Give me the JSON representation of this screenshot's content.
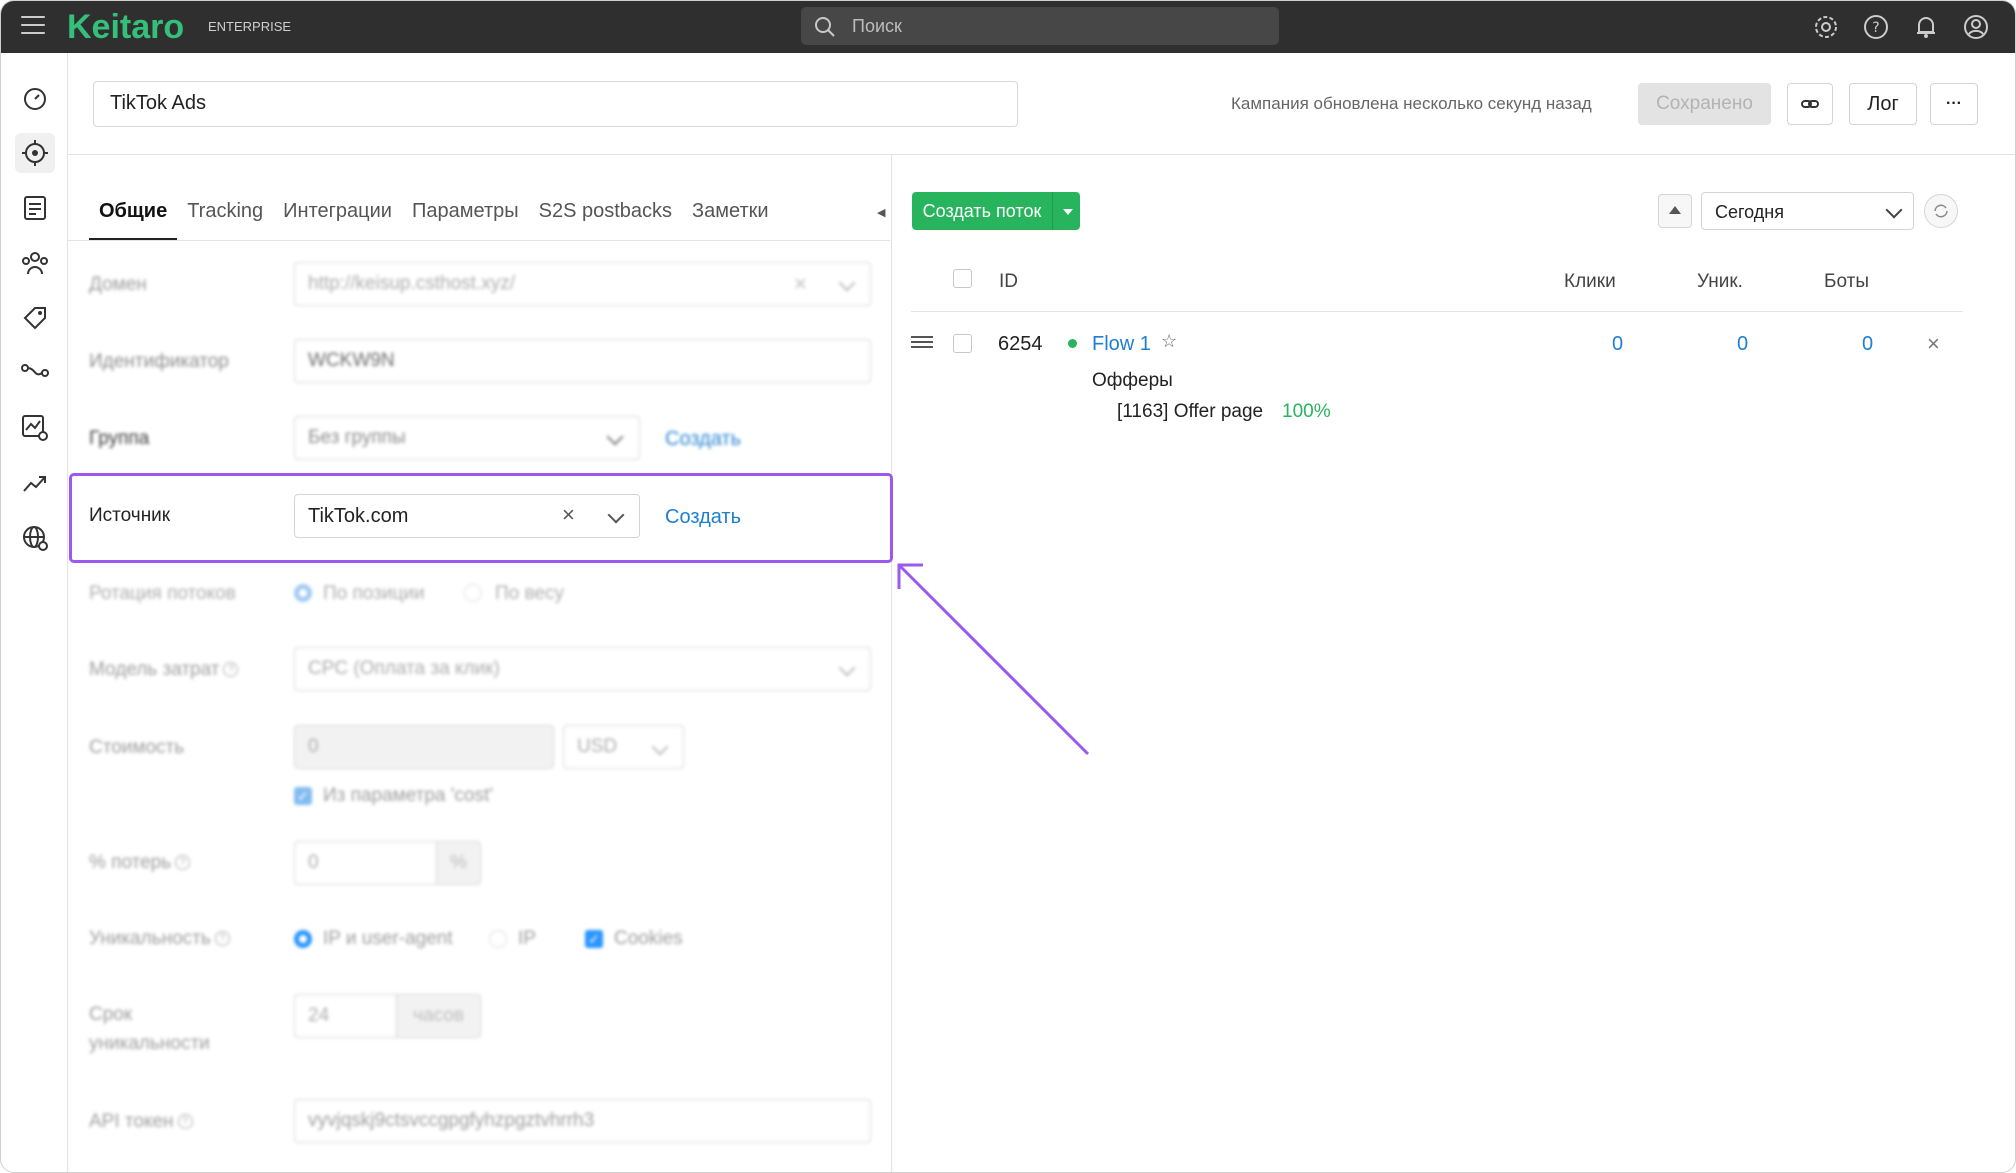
{
  "topbar": {
    "logo": "Keitaro",
    "edition": "ENTERPRISE",
    "search_placeholder": "Поиск",
    "icons": [
      "settings-icon",
      "help-icon",
      "bell-icon",
      "user-icon"
    ]
  },
  "sidebar": {
    "icons": [
      "dashboard-icon",
      "campaigns-icon",
      "landing-pages-icon",
      "users-icon",
      "offers-icon",
      "flows-icon",
      "reports-icon",
      "trends-icon",
      "domains-icon"
    ],
    "active": "campaigns-icon"
  },
  "header": {
    "campaign_name": "TikTok Ads",
    "status_text": "Кампания обновлена несколько секунд назад",
    "saved_label": "Сохранено",
    "log_label": "Лог",
    "more_label": "···"
  },
  "tabs": [
    {
      "label": "Общие",
      "active": true
    },
    {
      "label": "Tracking",
      "active": false
    },
    {
      "label": "Интеграции",
      "active": false
    },
    {
      "label": "Параметры",
      "active": false
    },
    {
      "label": "S2S postbacks",
      "active": false
    },
    {
      "label": "Заметки",
      "active": false
    }
  ],
  "form": {
    "domain": {
      "label": "Домен",
      "value": "http://keisup.csthost.xyz/"
    },
    "identifier": {
      "label": "Идентификатор",
      "value": "WCKW9N"
    },
    "group": {
      "label": "Группа",
      "value": "Без группы",
      "create": "Создать"
    },
    "source": {
      "label": "Источник",
      "value": "TikTok.com",
      "create": "Создать"
    },
    "rotation": {
      "label": "Ротация потоков",
      "opt1": "По позиции",
      "opt2": "По весу"
    },
    "cost_model": {
      "label": "Модель затрат",
      "value": "CPC (Оплата за клик)"
    },
    "cost": {
      "label": "Стоимость",
      "value": "0",
      "currency": "USD",
      "from_param": "Из параметра 'cost'"
    },
    "loss": {
      "label": "% потерь",
      "value": "0",
      "unit": "%"
    },
    "uniqueness": {
      "label": "Уникальность",
      "opt1": "IP и user-agent",
      "opt2": "IP",
      "opt3": "Cookies"
    },
    "uniq_term": {
      "label_line1": "Срок",
      "label_line2": "уникальности",
      "value": "24",
      "unit": "часов"
    },
    "api_token": {
      "label": "API токен",
      "value": "vyvjqskj9ctsvccgpgfyhzpgztvhrrh3"
    }
  },
  "flows": {
    "create_label": "Создать поток",
    "period": "Сегодня",
    "columns": {
      "id": "ID",
      "clicks": "Клики",
      "uniq": "Уник.",
      "bots": "Боты"
    },
    "rows": [
      {
        "id": "6254",
        "name": "Flow 1",
        "clicks": "0",
        "uniq": "0",
        "bots": "0",
        "offers_label": "Офферы",
        "offer_name": "[1163] Offer page",
        "offer_share": "100%"
      }
    ]
  },
  "colors": {
    "brand": "#35c079",
    "accent": "#1e7fd2",
    "highlight": "#9b59f0",
    "green_button": "#27b45d"
  }
}
